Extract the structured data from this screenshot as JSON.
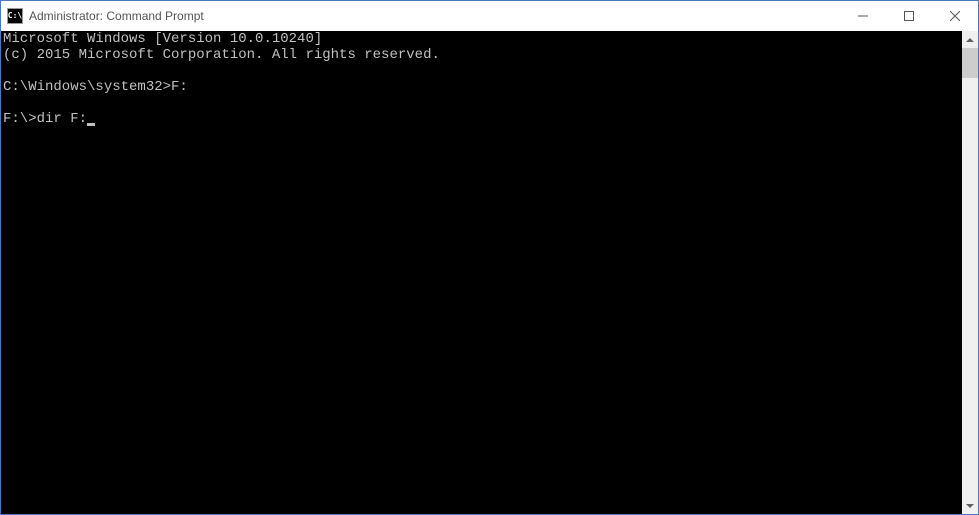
{
  "window": {
    "title": "Administrator: Command Prompt",
    "icon_label": "C:\\"
  },
  "terminal": {
    "lines": [
      "Microsoft Windows [Version 10.0.10240]",
      "(c) 2015 Microsoft Corporation. All rights reserved.",
      "",
      "C:\\Windows\\system32>F:",
      "",
      "F:\\>dir F:"
    ]
  }
}
